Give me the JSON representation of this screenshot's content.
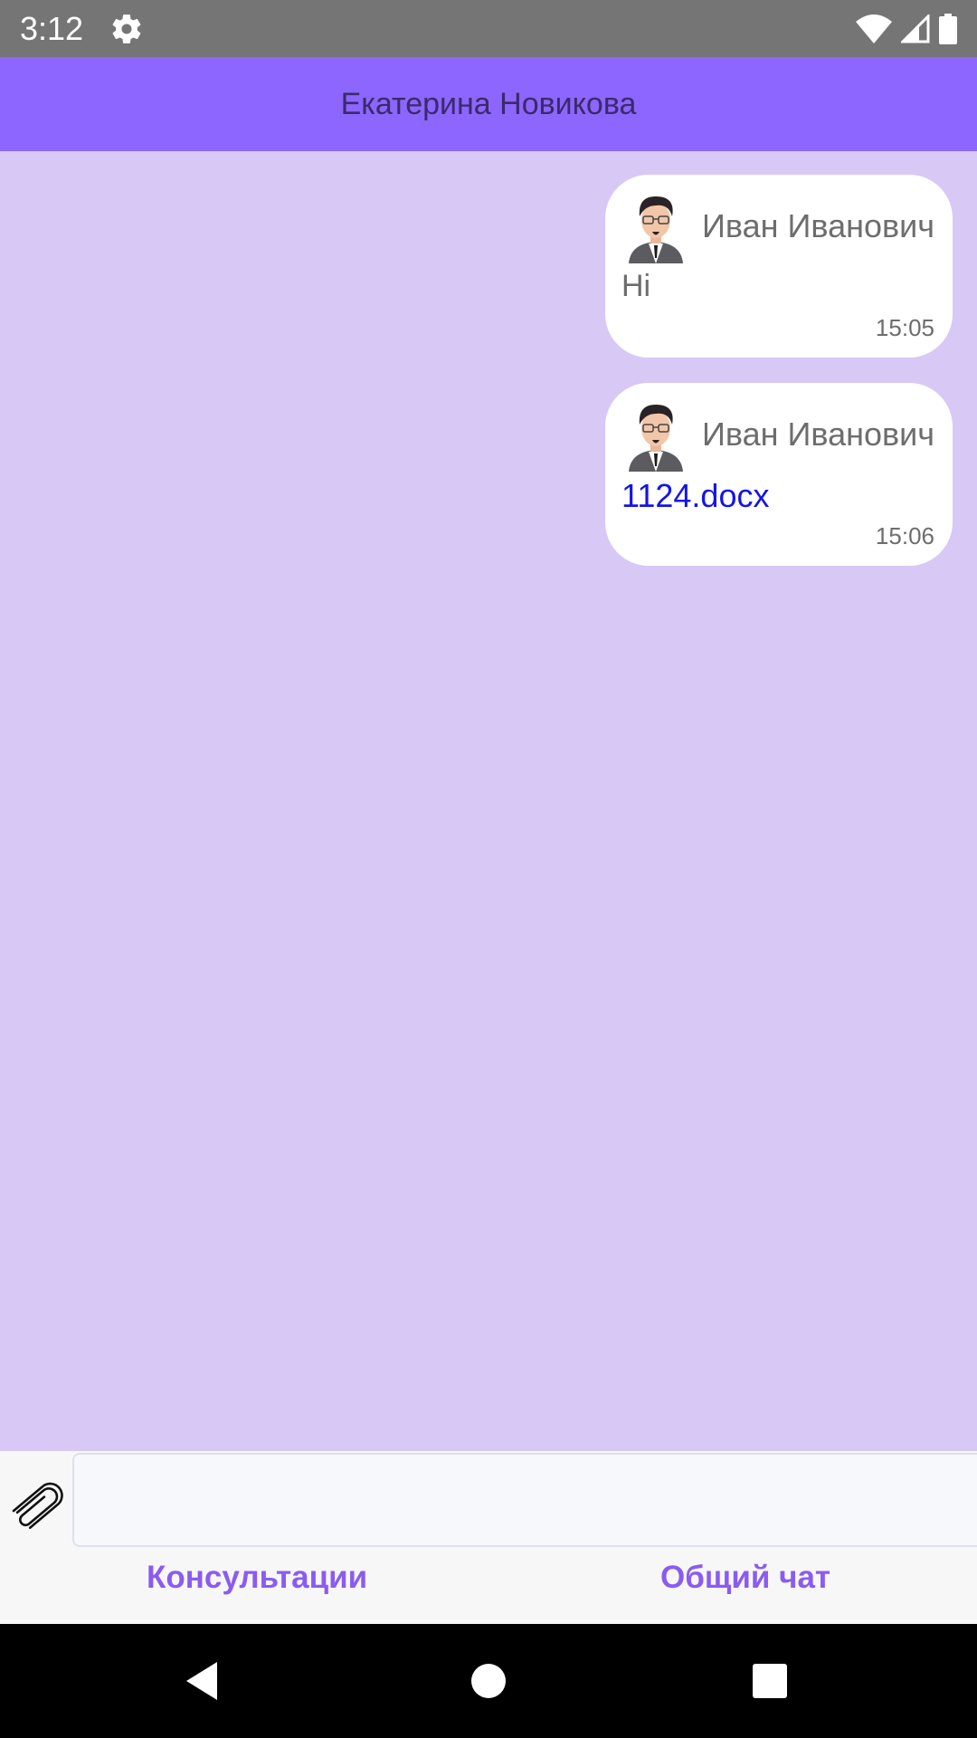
{
  "status_bar": {
    "time": "3:12",
    "icons": [
      "gear-icon",
      "wifi-icon",
      "signal-icon",
      "battery-icon"
    ]
  },
  "header": {
    "title": "Екатерина Новикова"
  },
  "messages": [
    {
      "sender": "Иван Иванович",
      "text": "Hi",
      "time": "15:05",
      "avatar": "businessman-avatar"
    },
    {
      "sender": "Иван Иванович",
      "attachment": "1124.docx",
      "time": "15:06",
      "avatar": "businessman-avatar"
    }
  ],
  "composer": {
    "value": "",
    "placeholder": "",
    "attach_icon": "paperclip-icon"
  },
  "tabs": [
    {
      "label": "Консультации"
    },
    {
      "label": "Общий чат"
    }
  ],
  "nav_bar": {
    "icons": [
      "back-icon",
      "home-icon",
      "recent-apps-icon"
    ]
  },
  "colors": {
    "status_bar": "#757575",
    "app_bar": "#8c66ff",
    "chat_background": "#d8c8f6",
    "tab_text": "#8a5cf0",
    "link": "#1414e6"
  }
}
